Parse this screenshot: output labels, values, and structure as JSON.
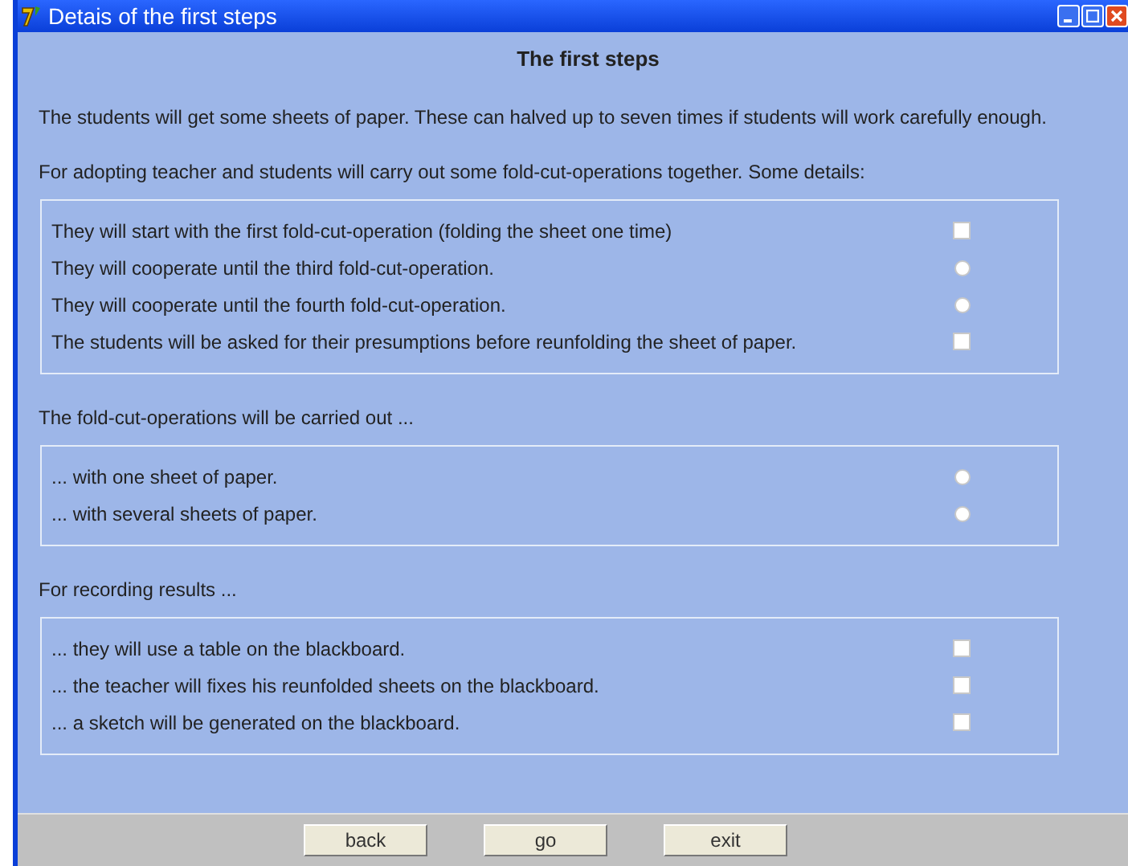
{
  "window": {
    "title": "Detais of the first steps"
  },
  "heading": "The first steps",
  "intro": "The students will get some sheets of paper. These can halved up to seven times if students will work carefully enough.",
  "groups": [
    {
      "label": "For adopting teacher and students will carry out some fold-cut-operations together. Some details:",
      "items": [
        {
          "text": "They will start with the first fold-cut-operation (folding the sheet one time)",
          "kind": "checkbox",
          "checked": false
        },
        {
          "text": "They will cooperate until the third fold-cut-operation.",
          "kind": "radio",
          "checked": false
        },
        {
          "text": "They will cooperate until the fourth fold-cut-operation.",
          "kind": "radio",
          "checked": false
        },
        {
          "text": "The students will be asked for their presumptions before reunfolding the sheet of paper.",
          "kind": "checkbox",
          "checked": false
        }
      ]
    },
    {
      "label": "The fold-cut-operations will be carried out ...",
      "items": [
        {
          "text": "... with one sheet of paper.",
          "kind": "radio",
          "checked": false
        },
        {
          "text": "... with several sheets of paper.",
          "kind": "radio",
          "checked": false
        }
      ]
    },
    {
      "label": "For recording results ...",
      "items": [
        {
          "text": "... they will use a table on the blackboard.",
          "kind": "checkbox",
          "checked": false
        },
        {
          "text": "... the teacher will fixes his reunfolded sheets on the blackboard.",
          "kind": "checkbox",
          "checked": false
        },
        {
          "text": "... a sketch will be generated on the blackboard.",
          "kind": "checkbox",
          "checked": false
        }
      ]
    }
  ],
  "buttons": [
    "back",
    "go",
    "exit"
  ]
}
